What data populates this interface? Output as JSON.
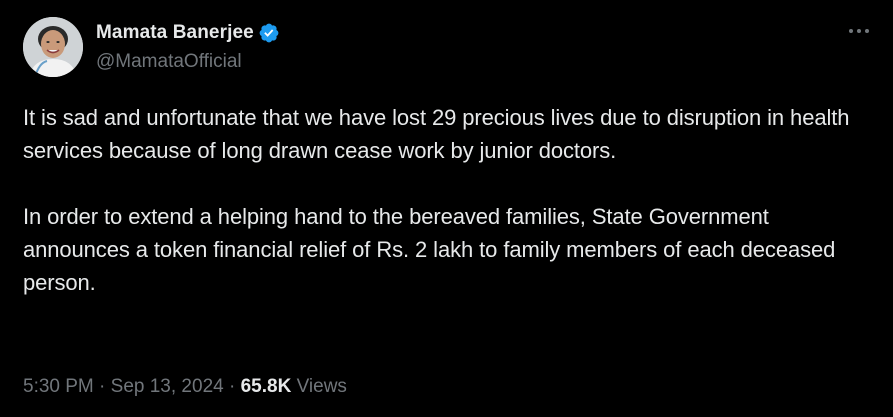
{
  "author": {
    "display_name": "Mamata Banerjee",
    "handle": "@MamataOfficial",
    "verified": true,
    "verified_color": "#1d9bf0"
  },
  "more_icon": "more-dots-icon",
  "tweet": {
    "paragraph_1": "It is sad and unfortunate that we have lost 29 precious lives due to disruption in health services because of long drawn cease work by junior doctors.",
    "paragraph_2": "In order to extend a helping hand to the bereaved families, State Government announces a token financial relief of Rs. 2 lakh to family members of each deceased person."
  },
  "meta": {
    "time": "5:30 PM",
    "separator": "·",
    "date": "Sep 13, 2024",
    "views_count": "65.8K",
    "views_label": "Views"
  },
  "colors": {
    "background": "#000000",
    "text_primary": "#e7e9ea",
    "text_secondary": "#71767b"
  }
}
